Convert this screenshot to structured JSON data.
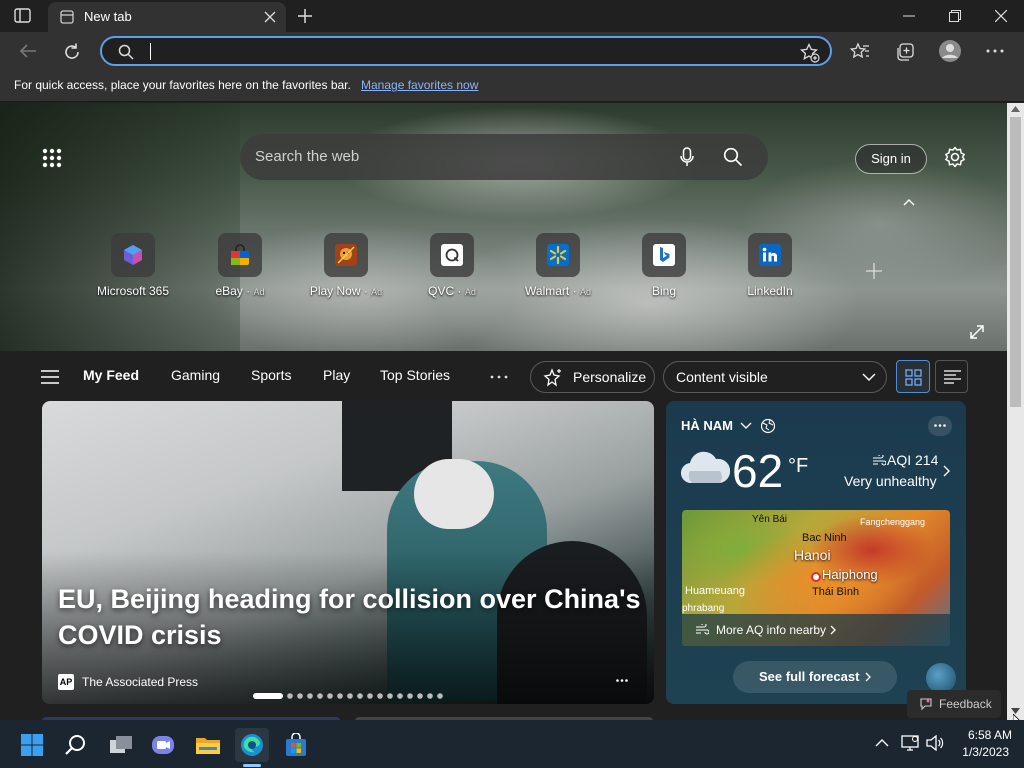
{
  "browser": {
    "tab_title": "New tab",
    "favorites_bar": {
      "message": "For quick access, place your favorites here on the favorites bar.",
      "link": "Manage favorites now"
    }
  },
  "newtab": {
    "search_placeholder": "Search the web",
    "signin_label": "Sign in",
    "quick_links": [
      {
        "label": "Microsoft 365",
        "ad": ""
      },
      {
        "label": "eBay",
        "ad": "Ad"
      },
      {
        "label": "Play Now",
        "ad": "Ad"
      },
      {
        "label": "QVC",
        "ad": "Ad"
      },
      {
        "label": "Walmart",
        "ad": "Ad"
      },
      {
        "label": "Bing",
        "ad": ""
      },
      {
        "label": "LinkedIn",
        "ad": ""
      }
    ],
    "feed_tabs": [
      "My Feed",
      "Gaming",
      "Sports",
      "Play",
      "Top Stories"
    ],
    "personalize_label": "Personalize",
    "content_visible_label": "Content visible",
    "headline": "EU, Beijing heading for collision over China's COVID crisis",
    "source": "The Associated Press",
    "source_logo_text": "AP",
    "weather": {
      "location": "HÀ NAM",
      "temp": "62",
      "unit": "°F",
      "aqi": "AQI 214",
      "aqi_status": "Very unhealthy",
      "map_labels": {
        "yenbai": "Yên Bái",
        "bacninh": "Bac Ninh",
        "hanoi": "Hanoi",
        "haiphong": "Haiphong",
        "fangcheng": "Fangchenggang",
        "huameuang": "Huameuang",
        "thaibinh": "Thái Bình",
        "phrabang": "phrabang"
      },
      "more_aq": "More AQ info nearby",
      "forecast_button": "See full forecast"
    },
    "feedback_label": "Feedback"
  },
  "taskbar": {
    "time": "6:58 AM",
    "date": "1/3/2023"
  }
}
